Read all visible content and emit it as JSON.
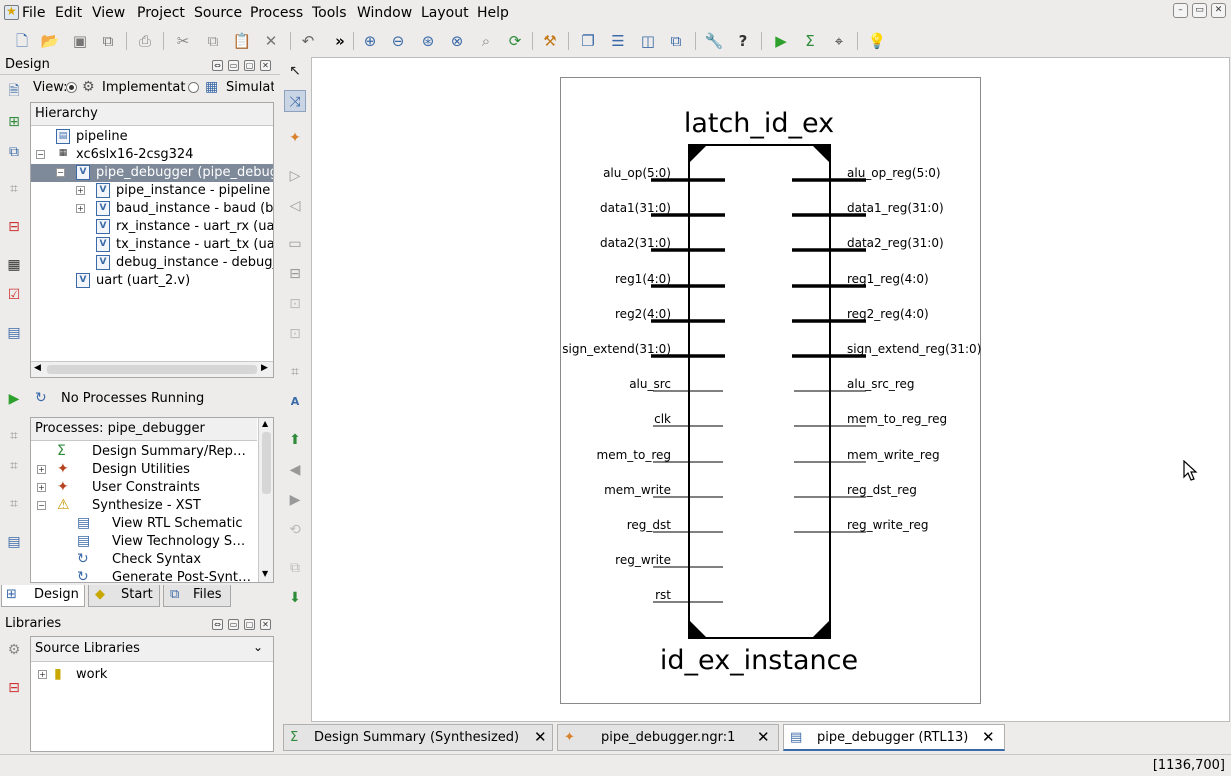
{
  "menu": [
    "File",
    "Edit",
    "View",
    "Project",
    "Source",
    "Process",
    "Tools",
    "Window",
    "Layout",
    "Help"
  ],
  "toolbar": {
    "icons": [
      "new-file-icon",
      "open-icon",
      "save-icon",
      "save-all-icon",
      "print-icon",
      "cut-icon",
      "copy-icon",
      "paste-icon",
      "delete-icon",
      "undo-icon",
      "more-icon",
      "zoom-in-icon",
      "zoom-out-icon",
      "zoom-full-icon",
      "zoom-fit-icon",
      "zoom-area-icon",
      "refresh-icon",
      "hammer-icon",
      "cascade-icon",
      "tile-horizontal-icon",
      "tile-vertical-icon",
      "float-icon",
      "wrench-icon",
      "help-icon",
      "run-icon",
      "sigma-icon",
      "telescope-icon",
      "bulb-icon"
    ]
  },
  "design_panel": {
    "title": "Design",
    "view_label": "View:",
    "view_options": [
      "Implementation",
      "Simulation"
    ],
    "hierarchy_header": "Hierarchy",
    "tree": [
      {
        "label": "pipeline",
        "indent": 0,
        "icon": "project"
      },
      {
        "label": "xc6slx16-2csg324",
        "indent": 0,
        "icon": "chip",
        "expander": "−"
      },
      {
        "label": "pipe_debugger (pipe_debugger.v)",
        "indent": 1,
        "icon": "verilog",
        "expander": "−",
        "selected": true
      },
      {
        "label": "pipe_instance - pipeline (pipeline.v)",
        "indent": 2,
        "icon": "verilog",
        "expander": "+"
      },
      {
        "label": "baud_instance - baud (baud.v)",
        "indent": 2,
        "icon": "verilog",
        "expander": "+"
      },
      {
        "label": "rx_instance - uart_rx (uart_rx.v)",
        "indent": 2,
        "icon": "verilog"
      },
      {
        "label": "tx_instance - uart_tx (uart_tx.v)",
        "indent": 2,
        "icon": "verilog"
      },
      {
        "label": "debug_instance - debug_unit (debug_unit.v)",
        "indent": 2,
        "icon": "verilog"
      },
      {
        "label": "uart (uart_2.v)",
        "indent": 1,
        "icon": "verilog"
      }
    ]
  },
  "process_panel": {
    "status": "No Processes Running",
    "header": "Processes: pipe_debugger",
    "items": [
      {
        "label": "Design Summary/Reports",
        "indent": 0,
        "icon": "Σ",
        "color": "#2e8b3a"
      },
      {
        "label": "Design Utilities",
        "indent": 0,
        "icon": "✦",
        "color": "#b5431f",
        "expander": "+"
      },
      {
        "label": "User Constraints",
        "indent": 0,
        "icon": "✦",
        "color": "#b5431f",
        "expander": "+"
      },
      {
        "label": "Synthesize - XST",
        "indent": 0,
        "icon": "⚠",
        "color": "#c99400",
        "expander": "−"
      },
      {
        "label": "View RTL Schematic",
        "indent": 1,
        "icon": "▤",
        "color": "#3b6aa8"
      },
      {
        "label": "View Technology Schematic",
        "indent": 1,
        "icon": "▤",
        "color": "#3b6aa8"
      },
      {
        "label": "Check Syntax",
        "indent": 1,
        "icon": "↻",
        "color": "#3b6aa8"
      },
      {
        "label": "Generate Post-Synthesis Simulation Model",
        "indent": 1,
        "icon": "↻",
        "color": "#3b6aa8"
      }
    ]
  },
  "panel_tabs": [
    "Design",
    "Start",
    "Files"
  ],
  "libraries_panel": {
    "title": "Libraries",
    "dropdown": "Source Libraries",
    "items": [
      "work"
    ]
  },
  "schematic": {
    "module_name": "latch_id_ex",
    "instance_name": "id_ex_instance",
    "inputs": [
      {
        "label": "alu_op(5:0)",
        "bus": true
      },
      {
        "label": "data1(31:0)",
        "bus": true
      },
      {
        "label": "data2(31:0)",
        "bus": true
      },
      {
        "label": "reg1(4:0)",
        "bus": true
      },
      {
        "label": "reg2(4:0)",
        "bus": true
      },
      {
        "label": "sign_extend(31:0)",
        "bus": true
      },
      {
        "label": "alu_src",
        "bus": false
      },
      {
        "label": "clk",
        "bus": false
      },
      {
        "label": "mem_to_reg",
        "bus": false
      },
      {
        "label": "mem_write",
        "bus": false
      },
      {
        "label": "reg_dst",
        "bus": false
      },
      {
        "label": "reg_write",
        "bus": false
      },
      {
        "label": "rst",
        "bus": false
      }
    ],
    "outputs": [
      {
        "label": "alu_op_reg(5:0)",
        "bus": true
      },
      {
        "label": "data1_reg(31:0)",
        "bus": true
      },
      {
        "label": "data2_reg(31:0)",
        "bus": true
      },
      {
        "label": "reg1_reg(4:0)",
        "bus": true
      },
      {
        "label": "reg2_reg(4:0)",
        "bus": true
      },
      {
        "label": "sign_extend_reg(31:0)",
        "bus": true
      },
      {
        "label": "alu_src_reg",
        "bus": false
      },
      {
        "label": "mem_to_reg_reg",
        "bus": false
      },
      {
        "label": "mem_write_reg",
        "bus": false
      },
      {
        "label": "reg_dst_reg",
        "bus": false
      },
      {
        "label": "reg_write_reg",
        "bus": false
      }
    ]
  },
  "editor_tabs": [
    {
      "label": "Design Summary (Synthesized)",
      "icon": "Σ",
      "active": false
    },
    {
      "label": "pipe_debugger.ngr:1",
      "icon": "✦",
      "active": false
    },
    {
      "label": "pipe_debugger (RTL13)",
      "icon": "▤",
      "active": true
    }
  ],
  "status_bar": {
    "coords": "[1136,700]"
  }
}
